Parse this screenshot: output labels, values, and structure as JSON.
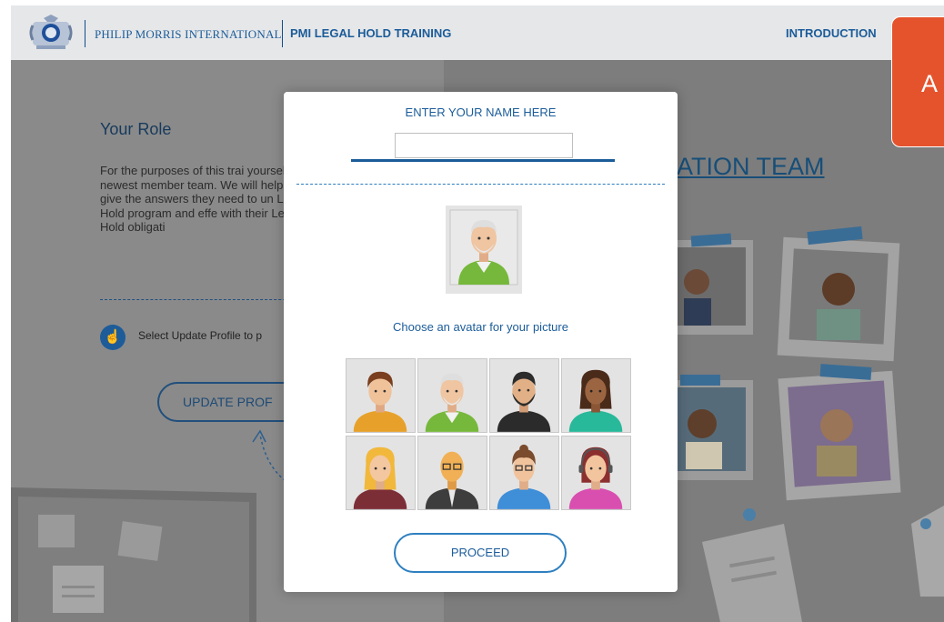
{
  "header": {
    "company": "PHILIP MORRIS INTERNATIONAL",
    "course_title": "PMI LEGAL HOLD TRAINING",
    "nav_introduction": "INTRODUCTION",
    "badge_text": "A"
  },
  "background": {
    "role_title": "Your Role",
    "role_body": "For the purposes of this trai yourself the newest member team. We will help you give the answers they need to un Legal Hold program and effe with their Legal Hold obligati",
    "hint_text": "Select Update Profile to p",
    "update_button": "UPDATE PROF",
    "team_heading": "ATION TEAM"
  },
  "modal": {
    "name_label": "ENTER YOUR NAME HERE",
    "name_value": "",
    "choose_label": "Choose an avatar for your picture",
    "proceed_label": "PROCEED",
    "selected_avatar": "older-man-green-shirt",
    "avatars": [
      {
        "id": "young-man-yellow",
        "skin": "#f0c29a",
        "hair": "#7a3f1e",
        "shirt": "#e7a12a"
      },
      {
        "id": "older-man-green-shirt",
        "skin": "#efc5a2",
        "hair": "#e6e6e6",
        "shirt": "#76b83b"
      },
      {
        "id": "bearded-man-dark",
        "skin": "#e2b087",
        "hair": "#2c2c2c",
        "shirt": "#2b2b2b"
      },
      {
        "id": "woman-teal",
        "skin": "#9c6542",
        "hair": "#4a2b1a",
        "shirt": "#27b99a"
      },
      {
        "id": "woman-blonde-maroon",
        "skin": "#f3c7a0",
        "hair": "#f1b83c",
        "shirt": "#7c2e36"
      },
      {
        "id": "bald-man-glasses-suit",
        "skin": "#f1b055",
        "hair": "#e89a34",
        "shirt": "#3d3d3d"
      },
      {
        "id": "woman-glasses-blue",
        "skin": "#f1c39d",
        "hair": "#7a4b2c",
        "shirt": "#3e8ed8"
      },
      {
        "id": "woman-headset-pink",
        "skin": "#f2c59e",
        "hair": "#8b2f2f",
        "shirt": "#d94fb0"
      }
    ]
  },
  "colors": {
    "brand_blue": "#1b5c99",
    "header_bg": "#e6e7e9",
    "accent_orange": "#e5532d"
  }
}
